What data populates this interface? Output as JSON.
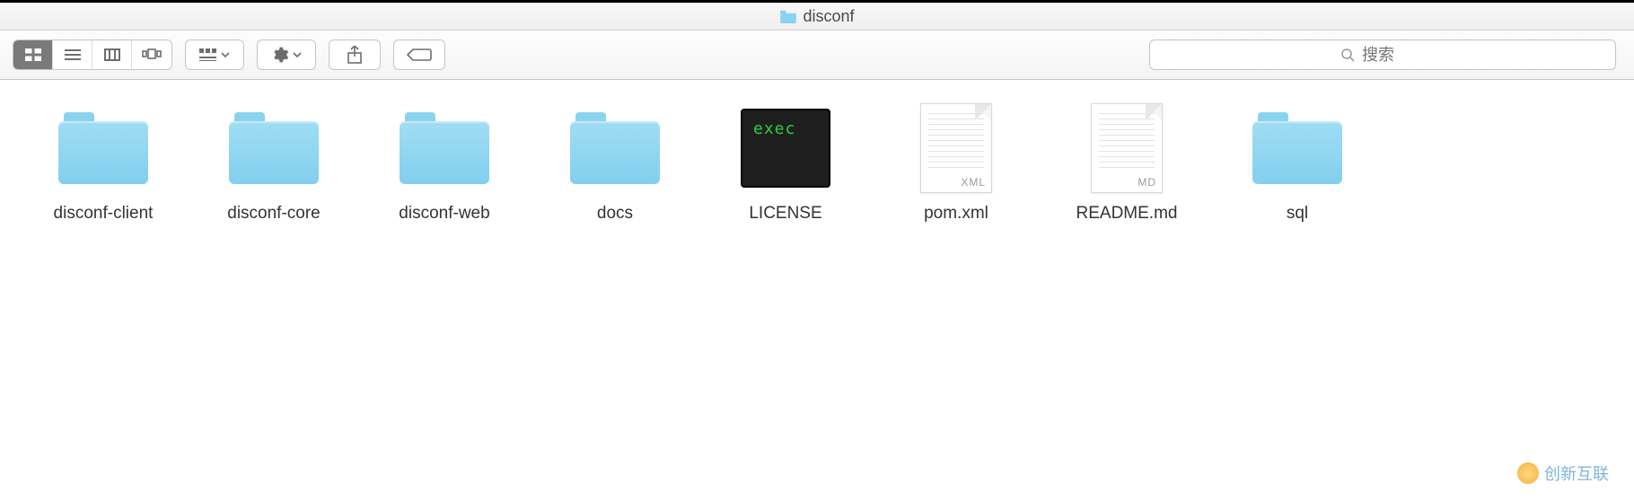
{
  "title": "disconf",
  "search": {
    "placeholder": "搜索"
  },
  "toolbar": {
    "view_icon": "icon-view-icon",
    "view_list": "list-view-icon",
    "view_column": "column-view-icon",
    "view_gallery": "gallery-view-icon",
    "group_menu": "group-by-icon",
    "action_menu": "action-gear-icon",
    "share": "share-icon",
    "tags": "tags-icon"
  },
  "exec_text": "exec",
  "items": [
    {
      "name": "disconf-client",
      "type": "folder"
    },
    {
      "name": "disconf-core",
      "type": "folder"
    },
    {
      "name": "disconf-web",
      "type": "folder"
    },
    {
      "name": "docs",
      "type": "folder"
    },
    {
      "name": "LICENSE",
      "type": "exec"
    },
    {
      "name": "pom.xml",
      "type": "doc",
      "ext": "XML"
    },
    {
      "name": "README.md",
      "type": "doc",
      "ext": "MD"
    },
    {
      "name": "sql",
      "type": "folder"
    }
  ],
  "watermark": "创新互联"
}
